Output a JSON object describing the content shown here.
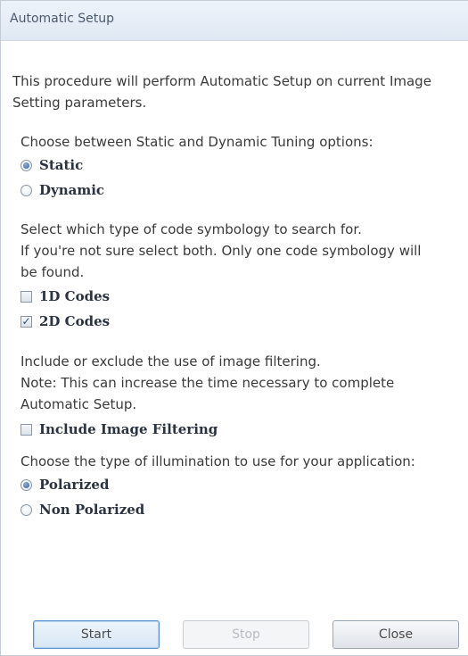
{
  "window": {
    "title": "Automatic Setup"
  },
  "intro": {
    "line1": "This procedure will perform Automatic Setup on current Image",
    "line2": "Setting parameters."
  },
  "tuning": {
    "prompt": "Choose between Static and Dynamic Tuning options:",
    "options": [
      {
        "label": "Static",
        "checked": true
      },
      {
        "label": "Dynamic",
        "checked": false
      }
    ]
  },
  "symbology": {
    "line1": "Select which type of code symbology to search for.",
    "line2": "If you're not sure select both. Only one code symbology will",
    "line3": "be found.",
    "options": [
      {
        "label": "1D Codes",
        "checked": false
      },
      {
        "label": "2D Codes",
        "checked": true
      }
    ]
  },
  "filtering": {
    "line1": "Include or exclude the use of image filtering.",
    "line2": "Note: This can increase the time necessary to complete",
    "line3": "Automatic Setup.",
    "option": {
      "label": "Include Image Filtering",
      "checked": false
    }
  },
  "illumination": {
    "prompt": "Choose the type of illumination to use for your application:",
    "options": [
      {
        "label": "Polarized",
        "checked": true
      },
      {
        "label": "Non Polarized",
        "checked": false
      }
    ]
  },
  "buttons": {
    "start": "Start",
    "stop": "Stop",
    "close": "Close"
  }
}
